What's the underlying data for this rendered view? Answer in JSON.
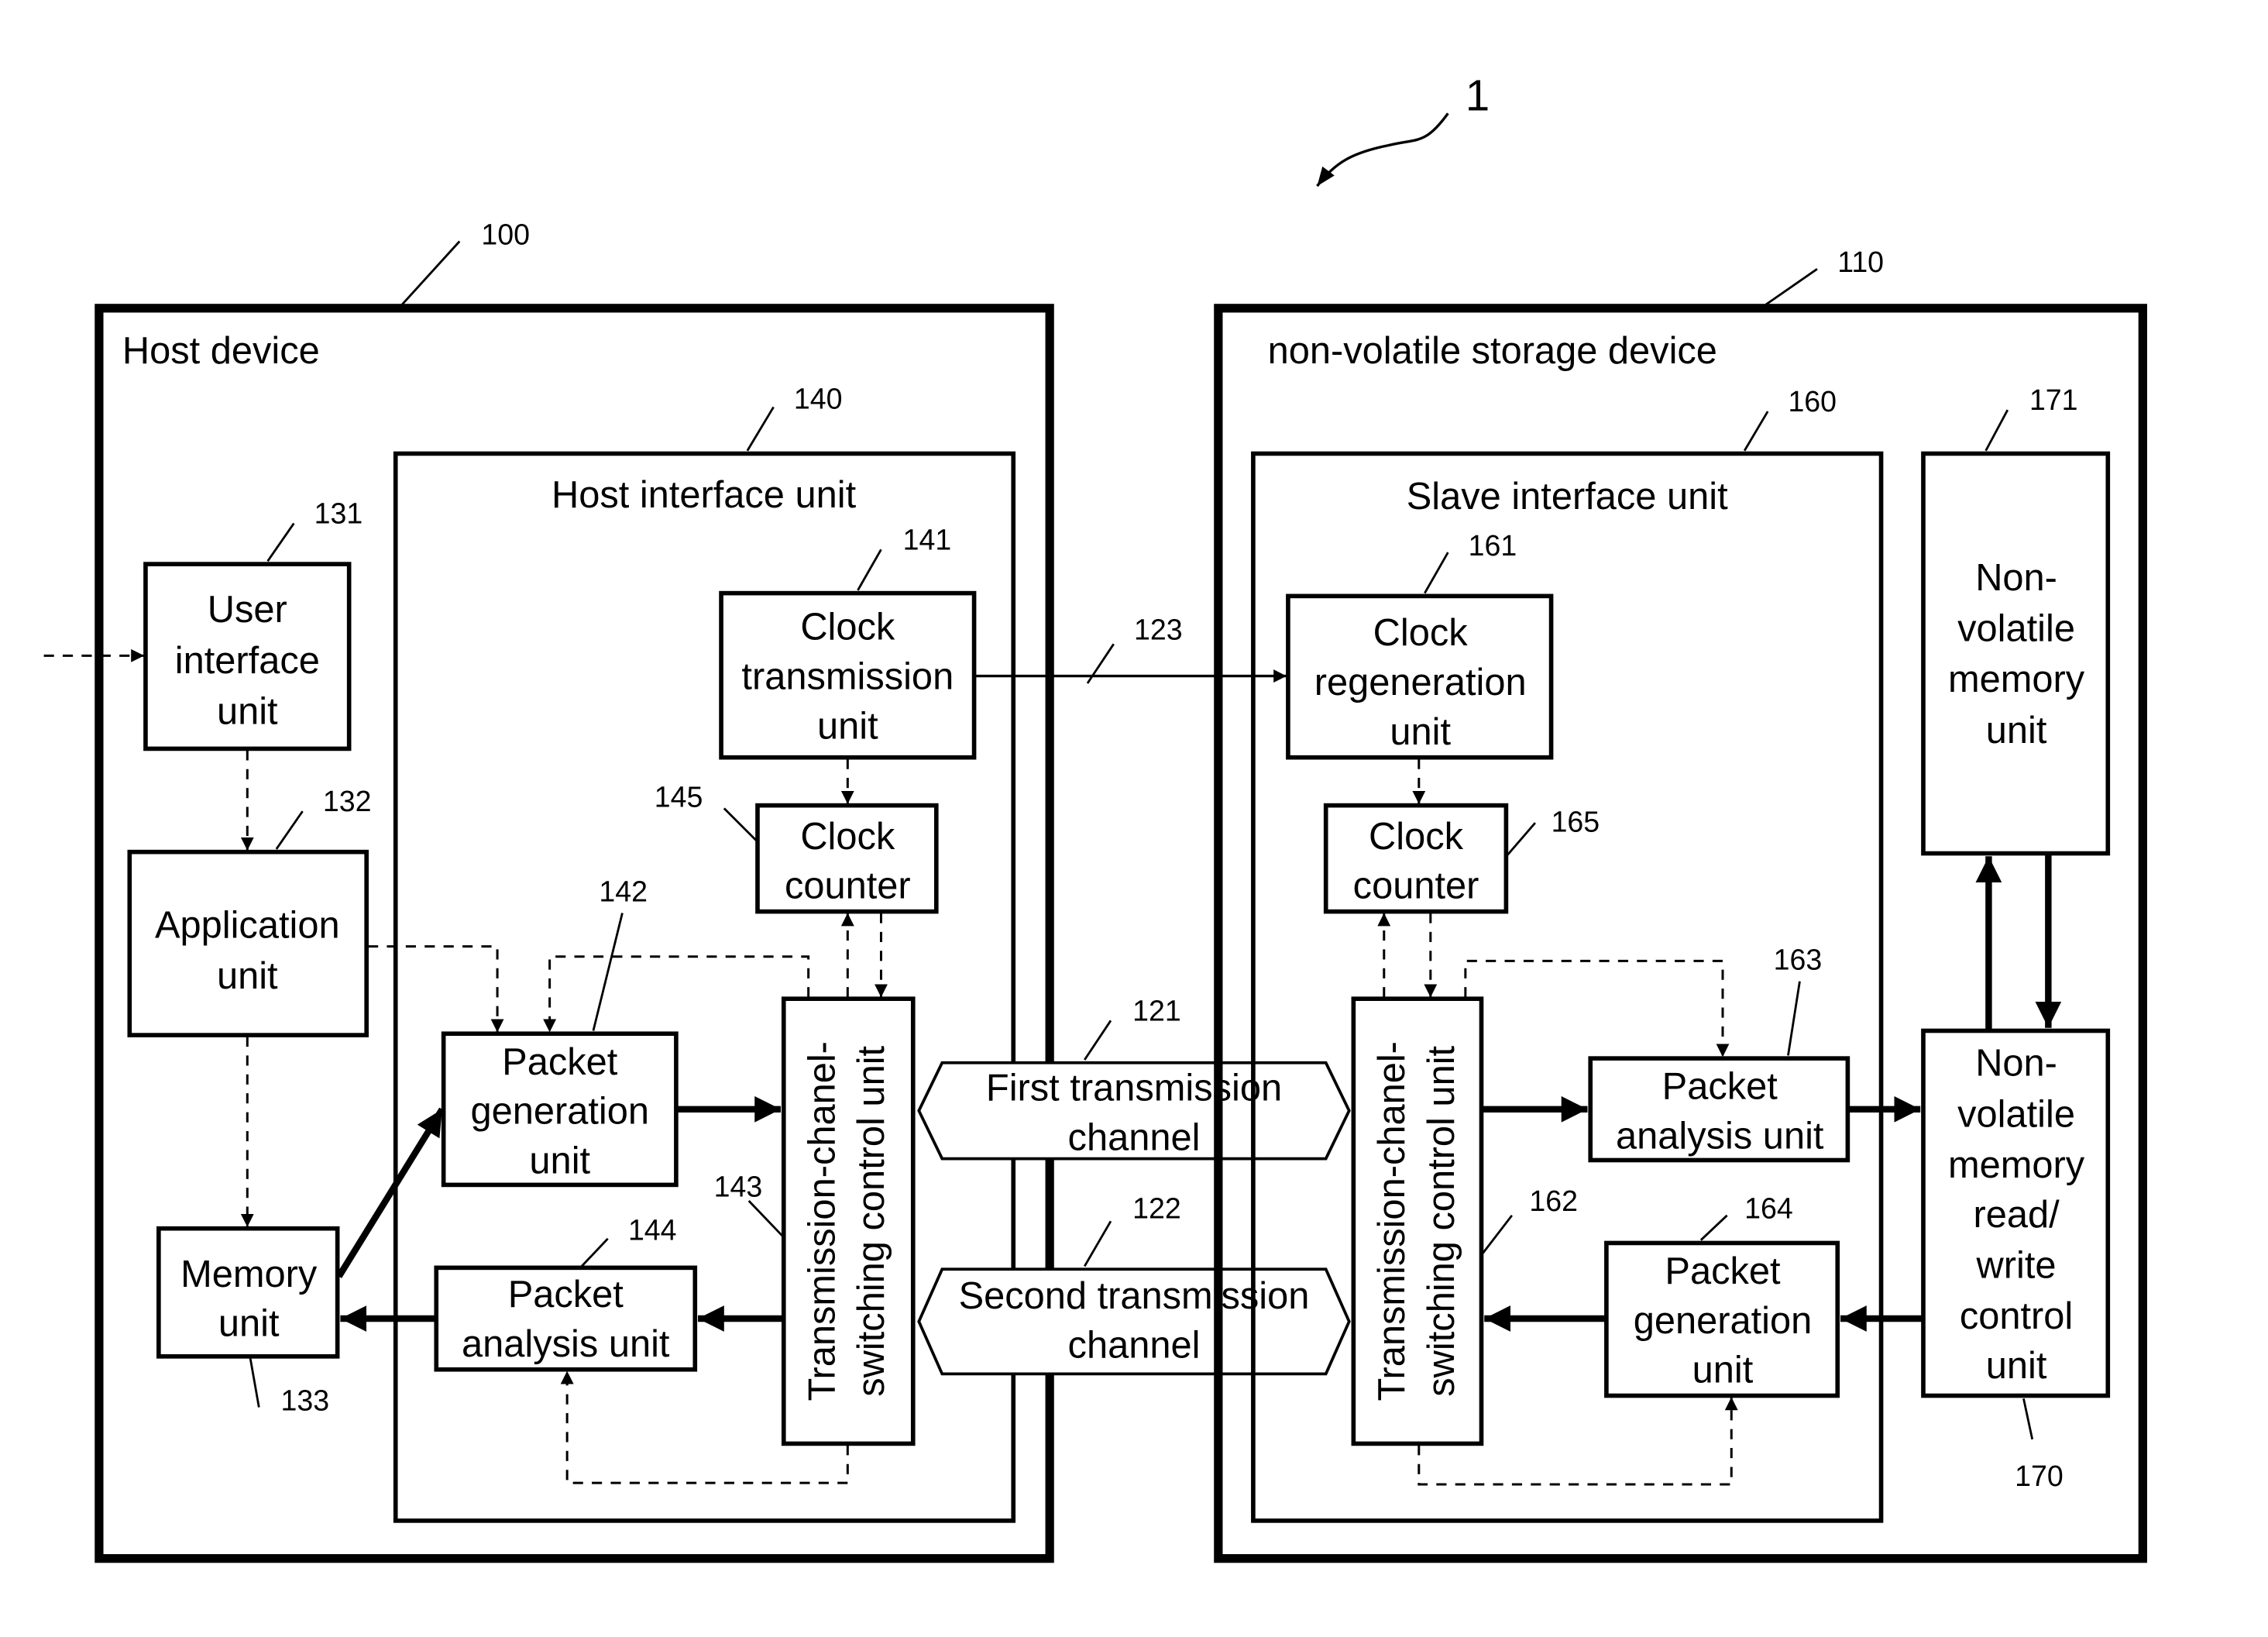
{
  "figure": {
    "system_ref": "1",
    "host": {
      "ref": "100",
      "title": "Host device",
      "user_interface": {
        "ref": "131",
        "lines": [
          "User",
          "interface",
          "unit"
        ]
      },
      "application": {
        "ref": "132",
        "lines": [
          "Application",
          "unit"
        ]
      },
      "memory": {
        "ref": "133",
        "lines": [
          "Memory",
          "unit"
        ]
      },
      "interface": {
        "ref": "140",
        "title": "Host interface unit",
        "clock_transmission": {
          "ref": "141",
          "lines": [
            "Clock",
            "transmission",
            "unit"
          ]
        },
        "packet_generation": {
          "ref": "142",
          "lines": [
            "Packet",
            "generation",
            "unit"
          ]
        },
        "switching_control": {
          "ref": "143",
          "lines": [
            "Transmission-chanel-",
            "switching control unit"
          ]
        },
        "packet_analysis": {
          "ref": "144",
          "lines": [
            "Packet",
            "analysis unit"
          ]
        },
        "clock_counter": {
          "ref": "145",
          "lines": [
            "Clock",
            "counter"
          ]
        }
      }
    },
    "channels": {
      "first": {
        "ref": "121",
        "lines": [
          "First transmission",
          "channel"
        ]
      },
      "second": {
        "ref": "122",
        "lines": [
          "Second transmission",
          "channel"
        ]
      },
      "clock_line": {
        "ref": "123"
      }
    },
    "storage": {
      "ref": "110",
      "title": "non-volatile storage device",
      "interface": {
        "ref": "160",
        "title": "Slave interface unit",
        "clock_regeneration": {
          "ref": "161",
          "lines": [
            "Clock",
            "regeneration",
            "unit"
          ]
        },
        "switching_control": {
          "ref": "162",
          "lines": [
            "Transmission-chanel-",
            "switching control unit"
          ]
        },
        "packet_analysis": {
          "ref": "163",
          "lines": [
            "Packet",
            "analysis unit"
          ]
        },
        "packet_generation": {
          "ref": "164",
          "lines": [
            "Packet",
            "generation",
            "unit"
          ]
        },
        "clock_counter": {
          "ref": "165",
          "lines": [
            "Clock",
            "counter"
          ]
        }
      },
      "rw_control": {
        "ref": "170",
        "lines": [
          "Non-",
          "volatile",
          "memory",
          "read/",
          "write",
          "control",
          "unit"
        ]
      },
      "memory_unit": {
        "ref": "171",
        "lines": [
          "Non-",
          "volatile",
          "memory",
          "unit"
        ]
      }
    }
  }
}
